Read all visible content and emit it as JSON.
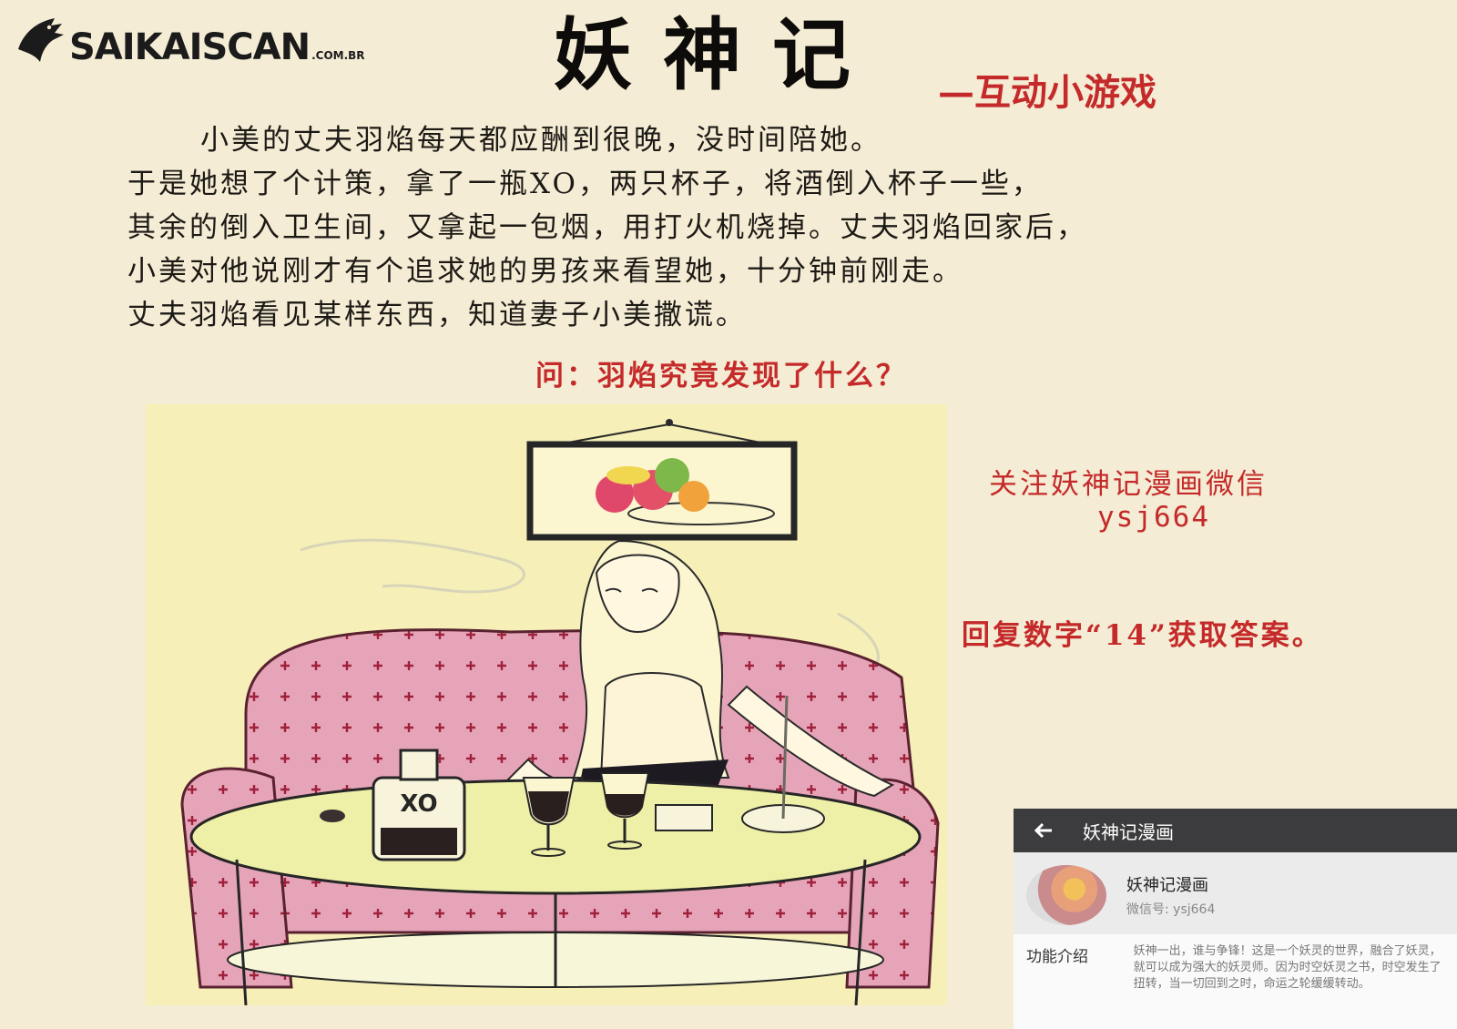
{
  "logo": {
    "text": "SAIKAISCAN",
    "suffix": ".COM.BR"
  },
  "title": "妖神记",
  "subtitle": "—互动小游戏",
  "story": {
    "lines": [
      "小美的丈夫羽焰每天都应酬到很晚，没时间陪她。",
      "于是她想了个计策，拿了一瓶XO，两只杯子，将酒倒入杯子一些，",
      "其余的倒入卫生间，又拿起一包烟，用打火机烧掉。丈夫羽焰回家后，",
      "小美对他说刚才有个追求她的男孩来看望她，十分钟前刚走。",
      "丈夫羽焰看见某样东西，知道妻子小美撒谎。"
    ]
  },
  "question": "问：羽焰究竟发现了什么？",
  "illustration": {
    "bottle_label": "XO"
  },
  "sidebar": {
    "follow": "关注妖神记漫画微信",
    "wechat_id": "ysj664",
    "reply": "回复数字“14”获取答案。"
  },
  "phone": {
    "header_title": "妖神记漫画",
    "profile_name": "妖神记漫画",
    "profile_id": "微信号: ysj664",
    "intro_label": "功能介绍",
    "intro_text": "妖神一出，谁与争锋！这是一个妖灵的世界，融合了妖灵，就可以成为强大的妖灵师。因为时空妖灵之书，时空发生了扭转，当一切回到之时，命运之轮缓缓转动。"
  },
  "colors": {
    "background": "#f4ecd4",
    "accent_red": "#c52a2a",
    "sofa_pink": "#e6a4b8",
    "table_yellow": "#eef0a8"
  }
}
